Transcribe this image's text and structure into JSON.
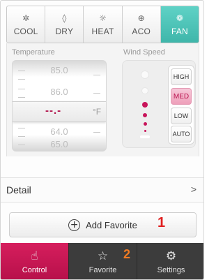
{
  "modes": [
    {
      "label": "COOL",
      "icon": "snowflake-icon",
      "glyph": "✲",
      "active": false
    },
    {
      "label": "DRY",
      "icon": "droplet-icon",
      "glyph": "◊",
      "active": false
    },
    {
      "label": "HEAT",
      "icon": "sun-icon",
      "glyph": "☼",
      "active": false
    },
    {
      "label": "ACO",
      "icon": "auto-mode-icon",
      "glyph": "⊕",
      "active": false
    },
    {
      "label": "FAN",
      "icon": "fan-icon",
      "glyph": "❁",
      "active": true
    }
  ],
  "temperature": {
    "label": "Temperature",
    "values_above": [
      "85.0",
      "86.0"
    ],
    "current": "--.-",
    "unit": "°F",
    "values_below": [
      "64.0",
      "65.0"
    ]
  },
  "wind_speed": {
    "label": "Wind Speed",
    "options": [
      "HIGH",
      "MED",
      "LOW",
      "AUTO"
    ],
    "selected": "MED"
  },
  "detail": {
    "label": "Detail",
    "chevron": ">"
  },
  "add_favorite": {
    "label": "Add Favorite",
    "annotation": "1"
  },
  "nav": {
    "items": [
      {
        "label": "Control",
        "icon": "hand-pointer-icon",
        "glyph": "☝",
        "active": true
      },
      {
        "label": "Favorite",
        "icon": "star-icon",
        "glyph": "☆",
        "active": false
      },
      {
        "label": "Settings",
        "icon": "gear-icon",
        "glyph": "⚙",
        "active": false
      }
    ],
    "annotation": "2"
  },
  "colors": {
    "accent_teal": "#4cc3b7",
    "accent_pink": "#c8145a",
    "annotation_red": "#e01f1f",
    "annotation_orange": "#f07a22"
  }
}
